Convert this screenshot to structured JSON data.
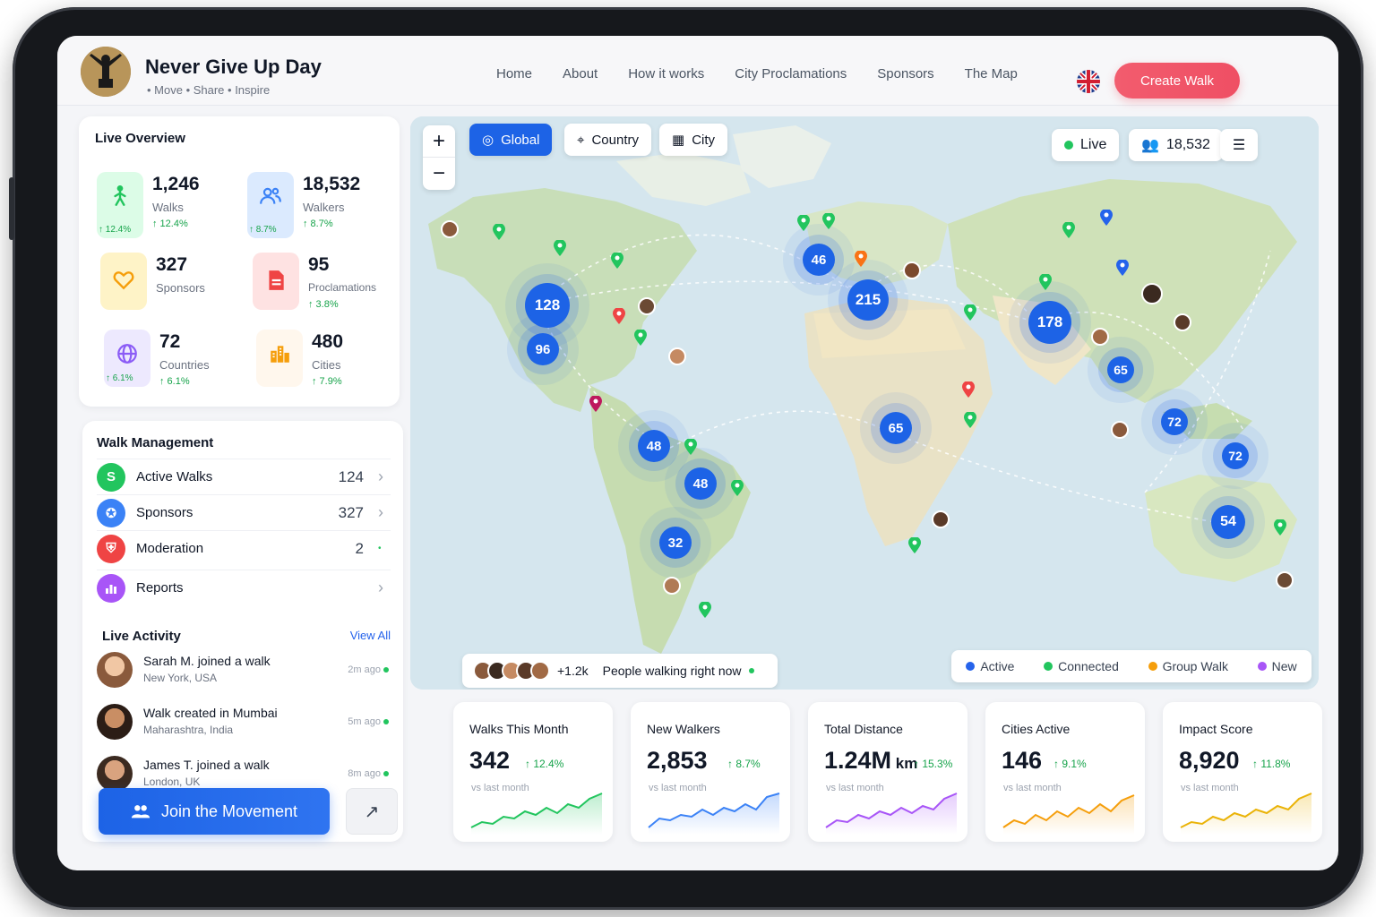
{
  "brand": {
    "title": "Never Give Up Day",
    "subtitle": "• Move • Share • Inspire"
  },
  "nav": [
    "Home",
    "About",
    "How it works",
    "City Proclamations",
    "Sponsors",
    "The Map"
  ],
  "header": {
    "create_walk": "Create Walk"
  },
  "overview": {
    "title": "Live Overview",
    "stats": [
      {
        "value": "1,246",
        "label": "Walks",
        "change": "↑ 12.4%",
        "icon": "walking-person-icon",
        "color": "#22c55e"
      },
      {
        "value": "18,532",
        "label": "Walkers",
        "change": "↑ 8.7%",
        "icon": "users-icon",
        "color": "#3b82f6"
      },
      {
        "value": "327",
        "label": "Sponsors",
        "change": "",
        "icon": "heart-icon",
        "color": "#f59e0b"
      },
      {
        "value": "95",
        "label": "Proclamations",
        "change": "↑ 3.8%",
        "icon": "document-icon",
        "color": "#ef4444"
      },
      {
        "value": "72",
        "label": "Countries",
        "change": "↑ 6.1%",
        "icon": "globe-icon",
        "color": "#8b5cf6"
      },
      {
        "value": "480",
        "label": "Cities",
        "change": "↑ 7.9%",
        "icon": "city-icon",
        "color": "#f59e0b"
      }
    ]
  },
  "management": {
    "title": "Walk Management",
    "rows": [
      {
        "label": "Active Walks",
        "count": "124",
        "icon": "walk-s-icon",
        "color": "#22c55e"
      },
      {
        "label": "Sponsors",
        "count": "327",
        "icon": "badge-icon",
        "color": "#3b82f6"
      },
      {
        "label": "Moderation",
        "count": "2",
        "icon": "shield-icon",
        "color": "#ef4444"
      },
      {
        "label": "Reports",
        "count": "",
        "icon": "bar-chart-icon",
        "color": "#a855f7"
      }
    ]
  },
  "activity": {
    "title": "Live Activity",
    "view_all": "View All",
    "items": [
      {
        "title": "Sarah M. joined a walk",
        "place": "New York, USA",
        "time": "2m ago"
      },
      {
        "title": "Walk created in Mumbai",
        "place": "Maharashtra, India",
        "time": "5m ago"
      },
      {
        "title": "James T. joined a walk",
        "place": "London, UK",
        "time": "8m ago"
      }
    ]
  },
  "actions": {
    "join": "Join the Movement"
  },
  "map": {
    "scopes": [
      "Global",
      "Country",
      "City"
    ],
    "active_scope": "Global",
    "live_label": "Live",
    "walkers_count": "18,532",
    "clusters": [
      "128",
      "96",
      "46",
      "215",
      "178",
      "65",
      "48",
      "48",
      "32",
      "65",
      "72",
      "72",
      "54"
    ],
    "walking_now_extra": "+1.2k",
    "walking_now_text": "People walking right now",
    "legend": [
      {
        "label": "Active",
        "color": "#2563eb"
      },
      {
        "label": "Connected",
        "color": "#22c55e"
      },
      {
        "label": "Group Walk",
        "color": "#f59e0b"
      },
      {
        "label": "New",
        "color": "#a855f7"
      }
    ]
  },
  "metrics": [
    {
      "title": "Walks This Month",
      "value": "342",
      "unit": "",
      "change": "↑ 12.4%",
      "sub": "vs last month",
      "color": "#22c55e"
    },
    {
      "title": "New Walkers",
      "value": "2,853",
      "unit": "",
      "change": "↑ 8.7%",
      "sub": "vs last month",
      "color": "#3b82f6"
    },
    {
      "title": "Total Distance",
      "value": "1.24M",
      "unit": " km",
      "change": "↑ 15.3%",
      "sub": "vs last month",
      "color": "#a855f7"
    },
    {
      "title": "Cities Active",
      "value": "146",
      "unit": "",
      "change": "↑ 9.1%",
      "sub": "vs last month",
      "color": "#f59e0b"
    },
    {
      "title": "Impact Score",
      "value": "8,920",
      "unit": "",
      "change": "↑ 11.8%",
      "sub": "vs last month",
      "color": "#eab308"
    }
  ]
}
